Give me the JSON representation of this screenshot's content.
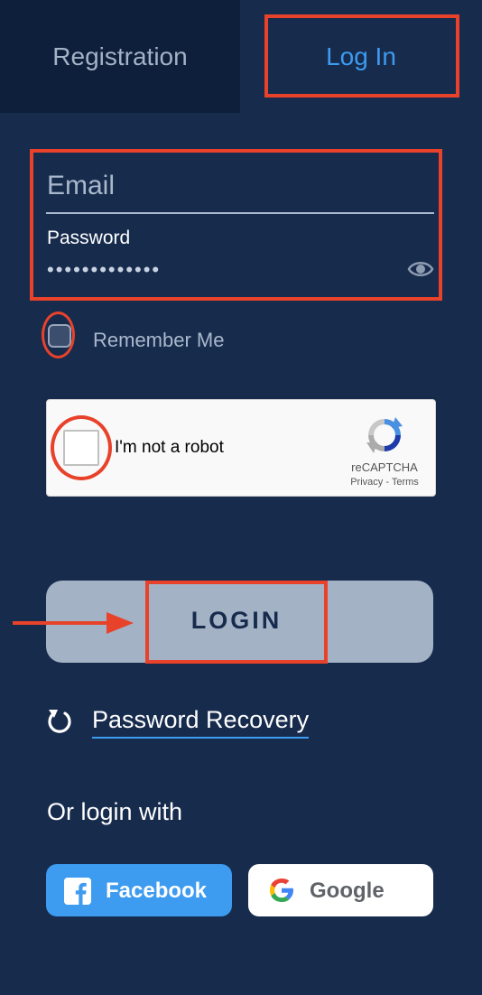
{
  "tabs": {
    "registration": "Registration",
    "login": "Log In"
  },
  "form": {
    "email_placeholder": "Email",
    "password_label": "Password",
    "password_value": "•••••••••••••",
    "remember_label": "Remember Me"
  },
  "recaptcha": {
    "label": "I'm not a robot",
    "brand": "reCAPTCHA",
    "privacy": "Privacy",
    "separator": " - ",
    "terms": "Terms"
  },
  "login_button": "LOGIN",
  "password_recovery": "Password Recovery",
  "social": {
    "heading": "Or login with",
    "facebook": "Facebook",
    "google": "Google"
  },
  "colors": {
    "background": "#172b4d",
    "accent": "#3d9bf0",
    "highlight": "#e8422b",
    "button": "#a4b2c5"
  },
  "icons": [
    "eye-icon",
    "recaptcha-logo-icon",
    "recovery-icon",
    "facebook-icon",
    "google-icon",
    "arrow-icon"
  ]
}
